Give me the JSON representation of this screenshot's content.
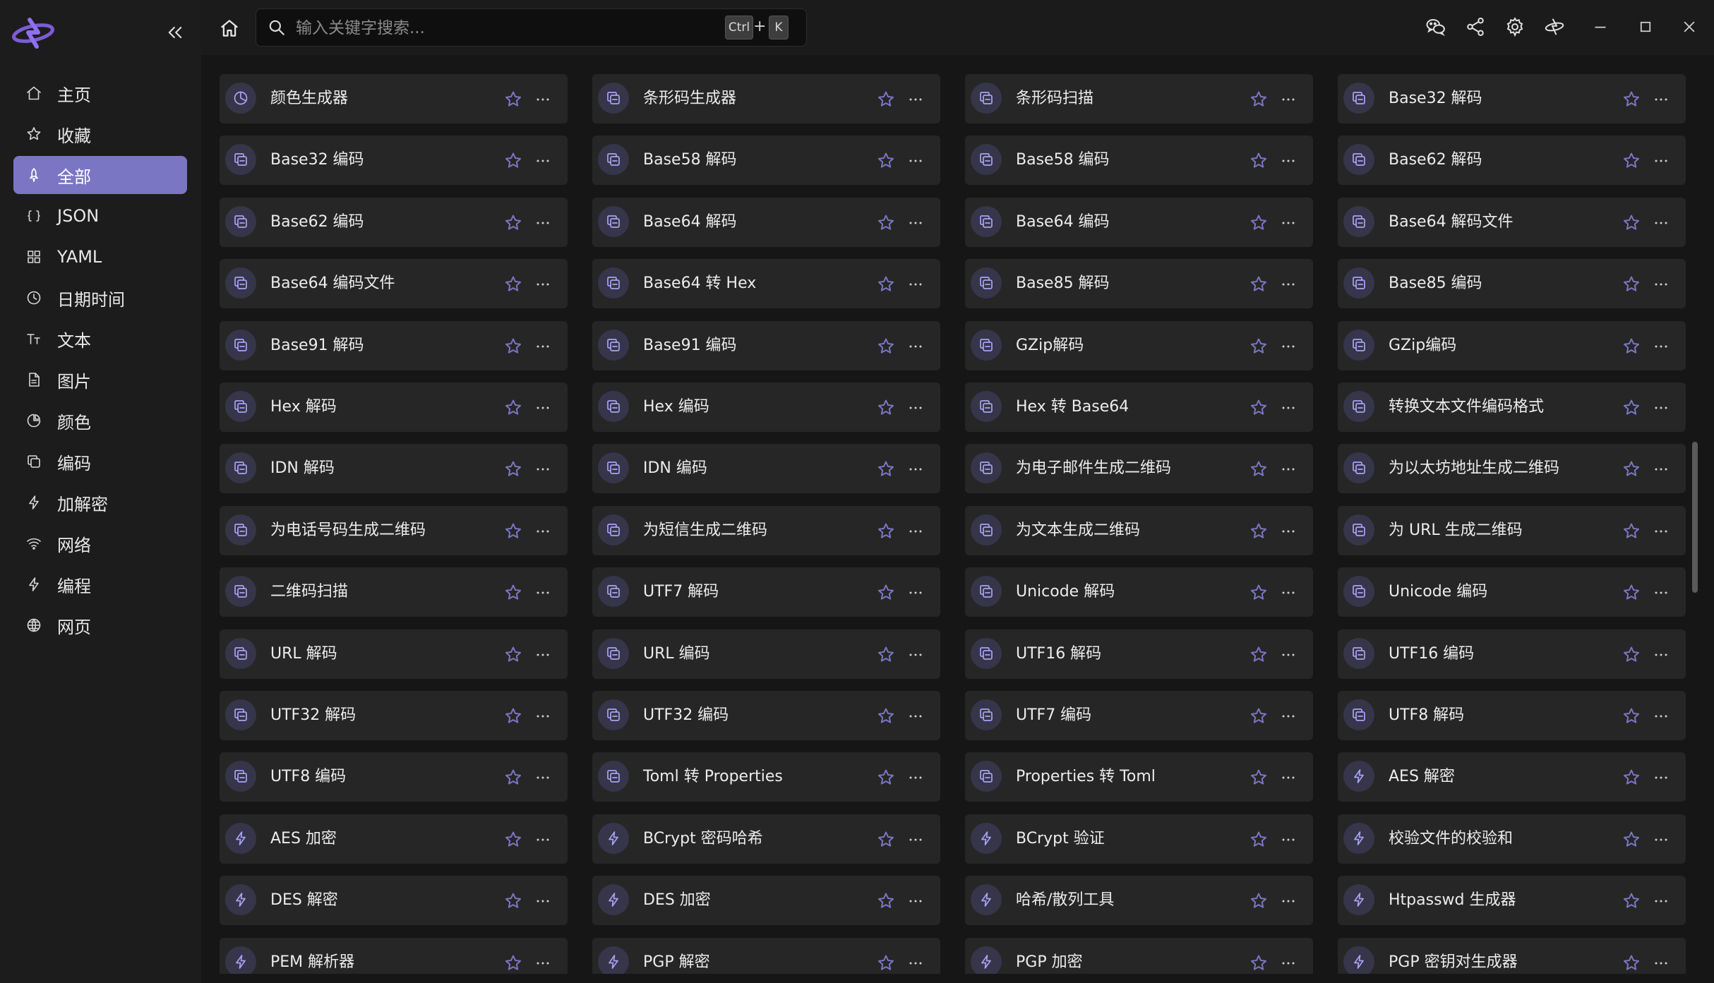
{
  "search": {
    "placeholder": "输入关键字搜索...",
    "value": "",
    "shortcut_ctrl": "Ctrl",
    "shortcut_plus": "+",
    "shortcut_key": "K"
  },
  "colors": {
    "accent": "#7b76c4",
    "icon_bg": "#36354a",
    "card_bg": "#262626"
  },
  "sidebar": {
    "items": [
      {
        "label": "主页",
        "icon": "home-icon"
      },
      {
        "label": "收藏",
        "icon": "star-icon"
      },
      {
        "label": "全部",
        "icon": "rocket-icon",
        "active": true
      },
      {
        "label": "JSON",
        "icon": "braces-icon"
      },
      {
        "label": "YAML",
        "icon": "grid-icon"
      },
      {
        "label": "日期时间",
        "icon": "clock-icon"
      },
      {
        "label": "文本",
        "icon": "text-icon"
      },
      {
        "label": "图片",
        "icon": "image-icon"
      },
      {
        "label": "颜色",
        "icon": "palette-icon"
      },
      {
        "label": "编码",
        "icon": "copy-icon"
      },
      {
        "label": "加解密",
        "icon": "bolt-icon"
      },
      {
        "label": "网络",
        "icon": "wifi-icon"
      },
      {
        "label": "编程",
        "icon": "bolt-icon"
      },
      {
        "label": "网页",
        "icon": "globe-icon"
      }
    ]
  },
  "tools": [
    {
      "label": "颜色生成器",
      "icon": "palette"
    },
    {
      "label": "条形码生成器",
      "icon": "copy"
    },
    {
      "label": "条形码扫描",
      "icon": "copy"
    },
    {
      "label": "Base32 解码",
      "icon": "copy"
    },
    {
      "label": "Base32 编码",
      "icon": "copy"
    },
    {
      "label": "Base58 解码",
      "icon": "copy"
    },
    {
      "label": "Base58 编码",
      "icon": "copy"
    },
    {
      "label": "Base62 解码",
      "icon": "copy"
    },
    {
      "label": "Base62 编码",
      "icon": "copy"
    },
    {
      "label": "Base64 解码",
      "icon": "copy"
    },
    {
      "label": "Base64 编码",
      "icon": "copy"
    },
    {
      "label": "Base64 解码文件",
      "icon": "copy"
    },
    {
      "label": "Base64 编码文件",
      "icon": "copy"
    },
    {
      "label": "Base64 转 Hex",
      "icon": "copy"
    },
    {
      "label": "Base85 解码",
      "icon": "copy"
    },
    {
      "label": "Base85 编码",
      "icon": "copy"
    },
    {
      "label": "Base91 解码",
      "icon": "copy"
    },
    {
      "label": "Base91 编码",
      "icon": "copy"
    },
    {
      "label": "GZip解码",
      "icon": "copy"
    },
    {
      "label": "GZip编码",
      "icon": "copy"
    },
    {
      "label": "Hex 解码",
      "icon": "copy"
    },
    {
      "label": "Hex 编码",
      "icon": "copy"
    },
    {
      "label": "Hex 转 Base64",
      "icon": "copy"
    },
    {
      "label": "转换文本文件编码格式",
      "icon": "copy"
    },
    {
      "label": "IDN 解码",
      "icon": "copy"
    },
    {
      "label": "IDN 编码",
      "icon": "copy"
    },
    {
      "label": "为电子邮件生成二维码",
      "icon": "copy"
    },
    {
      "label": "为以太坊地址生成二维码",
      "icon": "copy"
    },
    {
      "label": "为电话号码生成二维码",
      "icon": "copy"
    },
    {
      "label": "为短信生成二维码",
      "icon": "copy"
    },
    {
      "label": "为文本生成二维码",
      "icon": "copy"
    },
    {
      "label": "为 URL 生成二维码",
      "icon": "copy"
    },
    {
      "label": "二维码扫描",
      "icon": "copy"
    },
    {
      "label": "UTF7 解码",
      "icon": "copy"
    },
    {
      "label": "Unicode 解码",
      "icon": "copy"
    },
    {
      "label": "Unicode 编码",
      "icon": "copy"
    },
    {
      "label": "URL 解码",
      "icon": "copy"
    },
    {
      "label": "URL 编码",
      "icon": "copy"
    },
    {
      "label": "UTF16 解码",
      "icon": "copy"
    },
    {
      "label": "UTF16 编码",
      "icon": "copy"
    },
    {
      "label": "UTF32 解码",
      "icon": "copy"
    },
    {
      "label": "UTF32 编码",
      "icon": "copy"
    },
    {
      "label": "UTF7 编码",
      "icon": "copy"
    },
    {
      "label": "UTF8 解码",
      "icon": "copy"
    },
    {
      "label": "UTF8 编码",
      "icon": "copy"
    },
    {
      "label": "Toml 转 Properties",
      "icon": "copy"
    },
    {
      "label": "Properties 转 Toml",
      "icon": "copy"
    },
    {
      "label": "AES 解密",
      "icon": "bolt"
    },
    {
      "label": "AES 加密",
      "icon": "bolt"
    },
    {
      "label": "BCrypt 密码哈希",
      "icon": "bolt"
    },
    {
      "label": "BCrypt 验证",
      "icon": "bolt"
    },
    {
      "label": "校验文件的校验和",
      "icon": "bolt"
    },
    {
      "label": "DES 解密",
      "icon": "bolt"
    },
    {
      "label": "DES 加密",
      "icon": "bolt"
    },
    {
      "label": "哈希/散列工具",
      "icon": "bolt"
    },
    {
      "label": "Htpasswd 生成器",
      "icon": "bolt"
    },
    {
      "label": "PEM 解析器",
      "icon": "bolt"
    },
    {
      "label": "PGP 解密",
      "icon": "bolt"
    },
    {
      "label": "PGP 加密",
      "icon": "bolt"
    },
    {
      "label": "PGP 密钥对生成器",
      "icon": "bolt"
    }
  ]
}
